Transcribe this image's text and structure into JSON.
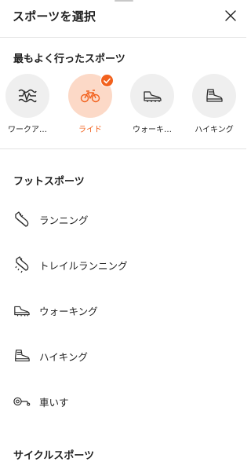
{
  "header": {
    "title": "スポーツを選択"
  },
  "recent": {
    "title": "最もよく行ったスポーツ",
    "items": [
      {
        "label": "ワークア…",
        "icon": "workout-icon",
        "selected": false
      },
      {
        "label": "ライド",
        "icon": "bike-icon",
        "selected": true
      },
      {
        "label": "ウォーキ…",
        "icon": "walking-shoe-icon",
        "selected": false
      },
      {
        "label": "ハイキング",
        "icon": "hiking-boot-icon",
        "selected": false
      }
    ]
  },
  "foot_sports": {
    "title": "フットスポーツ",
    "items": [
      {
        "label": "ランニング",
        "icon": "running-shoe-icon"
      },
      {
        "label": "トレイルランニング",
        "icon": "trail-run-shoe-icon"
      },
      {
        "label": "ウォーキング",
        "icon": "walking-shoe-icon"
      },
      {
        "label": "ハイキング",
        "icon": "hiking-boot-icon"
      },
      {
        "label": "車いす",
        "icon": "wheelchair-icon"
      }
    ]
  },
  "cycle_sports": {
    "title": "サイクルスポーツ"
  },
  "colors": {
    "accent": "#f2611d",
    "accent_light": "#fcd9c7",
    "circle_bg": "#efefef",
    "divider": "#e3e3e3"
  }
}
